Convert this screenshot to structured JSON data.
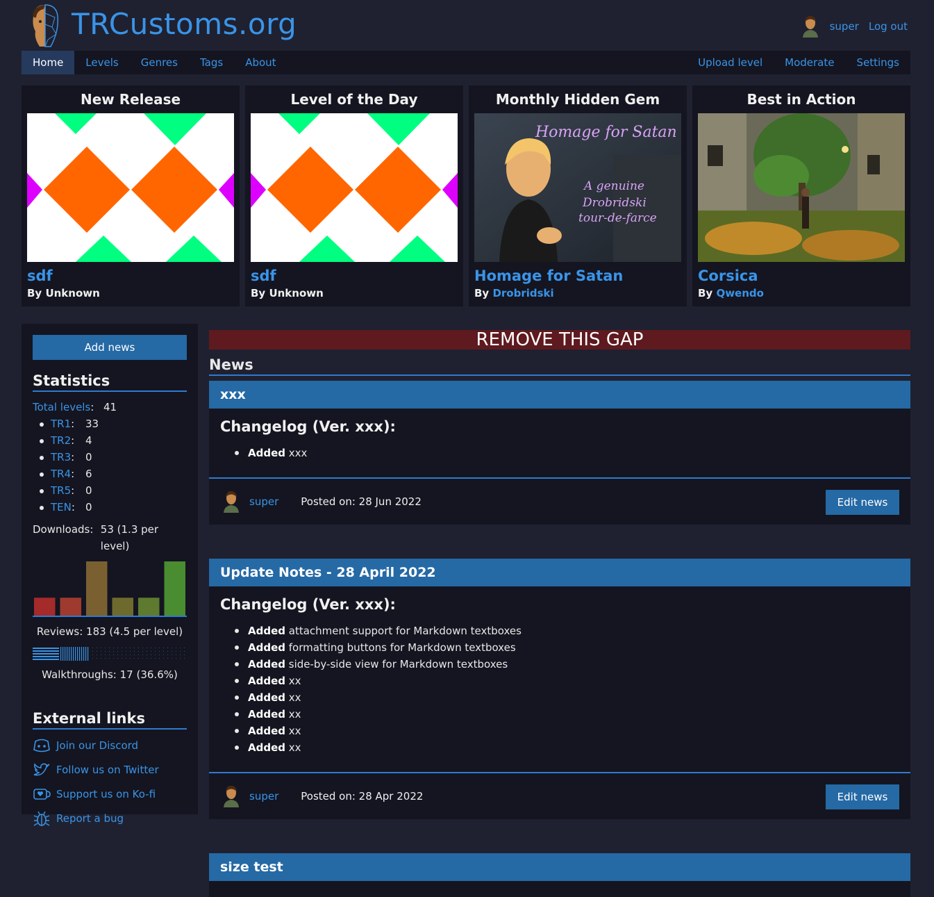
{
  "site": {
    "title": "TRCustoms.org"
  },
  "user": {
    "name": "super",
    "logout": "Log out"
  },
  "nav": {
    "left": [
      "Home",
      "Levels",
      "Genres",
      "Tags",
      "About"
    ],
    "right": [
      "Upload level",
      "Moderate",
      "Settings"
    ]
  },
  "features": [
    {
      "heading": "New Release",
      "name": "sdf",
      "by": "By",
      "author": "Unknown",
      "author_linked": false
    },
    {
      "heading": "Level of the Day",
      "name": "sdf",
      "by": "By",
      "author": "Unknown",
      "author_linked": false
    },
    {
      "heading": "Monthly Hidden Gem",
      "name": "Homage for Satan",
      "by": "By",
      "author": "Drobridski",
      "author_linked": true,
      "image_text": {
        "title": "Homage for Satan",
        "l1": "A genuine",
        "l2": "Drobridski",
        "l3": "tour-de-farce"
      }
    },
    {
      "heading": "Best in Action",
      "name": "Corsica",
      "by": "By",
      "author": "Qwendo",
      "author_linked": true
    }
  ],
  "sidebar": {
    "add_news": "Add news",
    "statistics_heading": "Statistics",
    "total_label": "Total levels",
    "total_value": "41",
    "engines": [
      {
        "name": "TR1",
        "value": "33"
      },
      {
        "name": "TR2",
        "value": "4"
      },
      {
        "name": "TR3",
        "value": "0"
      },
      {
        "name": "TR4",
        "value": "6"
      },
      {
        "name": "TR5",
        "value": "0"
      },
      {
        "name": "TEN",
        "value": "0"
      }
    ],
    "downloads_label": "Downloads:",
    "downloads_value": "53 (1.3 per level)",
    "rating_distribution": [
      {
        "value": 0.33,
        "color": "#a52a2a"
      },
      {
        "value": 0.33,
        "color": "#9e3b2e"
      },
      {
        "value": 1.0,
        "color": "#7a6030"
      },
      {
        "value": 0.33,
        "color": "#6e6a2e"
      },
      {
        "value": 0.33,
        "color": "#5e7a2e"
      },
      {
        "value": 1.0,
        "color": "#4a8c30"
      }
    ],
    "reviews_text": "Reviews: 183 (4.5 per level)",
    "walkthrough_fraction": 0.366,
    "walkthroughs_text": "Walkthroughs: 17 (36.6%)",
    "external_heading": "External links",
    "links": [
      {
        "label": "Join our Discord",
        "icon": "discord-icon"
      },
      {
        "label": "Follow us on Twitter",
        "icon": "twitter-icon"
      },
      {
        "label": "Support us on Ko-fi",
        "icon": "kofi-icon"
      },
      {
        "label": "Report a bug",
        "icon": "bug-icon"
      }
    ]
  },
  "banner": "REMOVE THIS GAP",
  "news_heading": "News",
  "news": [
    {
      "title": "xxx",
      "changelog": "Changelog (Ver. xxx):",
      "items": [
        {
          "b": "Added",
          "t": " xxx"
        }
      ],
      "author": "super",
      "posted": "Posted on: 28 Jun 2022",
      "edit": "Edit news"
    },
    {
      "title": "Update Notes - 28 April 2022",
      "changelog": "Changelog (Ver. xxx):",
      "items": [
        {
          "b": "Added",
          "t": " attachment support for Markdown textboxes"
        },
        {
          "b": "Added",
          "t": " formatting buttons for Markdown textboxes"
        },
        {
          "b": "Added",
          "t": " side-by-side view for Markdown textboxes"
        },
        {
          "b": "Added",
          "t": " xx"
        },
        {
          "b": "Added",
          "t": " xx"
        },
        {
          "b": "Added",
          "t": " xx"
        },
        {
          "b": "Added",
          "t": " xx"
        },
        {
          "b": "Added",
          "t": " xx"
        }
      ],
      "author": "super",
      "posted": "Posted on: 28 Apr 2022",
      "edit": "Edit news"
    },
    {
      "title": "size test"
    }
  ],
  "colors": {
    "accent": "#3a94e8",
    "header_bar": "#2569a5",
    "panel": "#141520",
    "background": "#1f2130",
    "banner": "#5e1a1f"
  }
}
